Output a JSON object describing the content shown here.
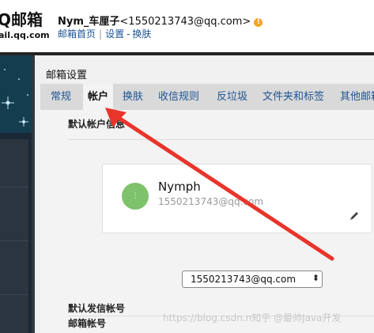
{
  "header": {
    "logo_text": "Q邮箱",
    "logo_domain": "ail.qq.com",
    "user_name": "Nym_车厘子",
    "user_email": "<1550213743@qq.com>",
    "links": [
      "邮箱首页",
      "设置",
      "换肤"
    ]
  },
  "settings": {
    "title": "邮箱设置",
    "tabs": [
      {
        "label": "常规",
        "active": false
      },
      {
        "label": "帐户",
        "active": true
      },
      {
        "label": "换肤",
        "active": false
      },
      {
        "label": "收信规则",
        "active": false
      },
      {
        "label": "反垃圾",
        "active": false
      },
      {
        "label": "文件夹和标签",
        "active": false
      },
      {
        "label": "其他邮箱",
        "active": false
      }
    ],
    "section_default_account": "默认帐户信息",
    "account": {
      "name": "Nymph",
      "email": "1550213743@qq.com",
      "avatar_text": "⋮"
    },
    "section_default_sender": "默认发信帐号",
    "sender_select": "1550213743@qq.com",
    "section_mail_account": "邮箱帐号"
  },
  "watermark": "https://blog.csdn.n知乎 @最帅Java开发",
  "colors": {
    "accent_link": "#1e5494",
    "annotation_arrow": "#e8342a",
    "avatar": "#7ec26b",
    "warning": "#f5a623"
  }
}
